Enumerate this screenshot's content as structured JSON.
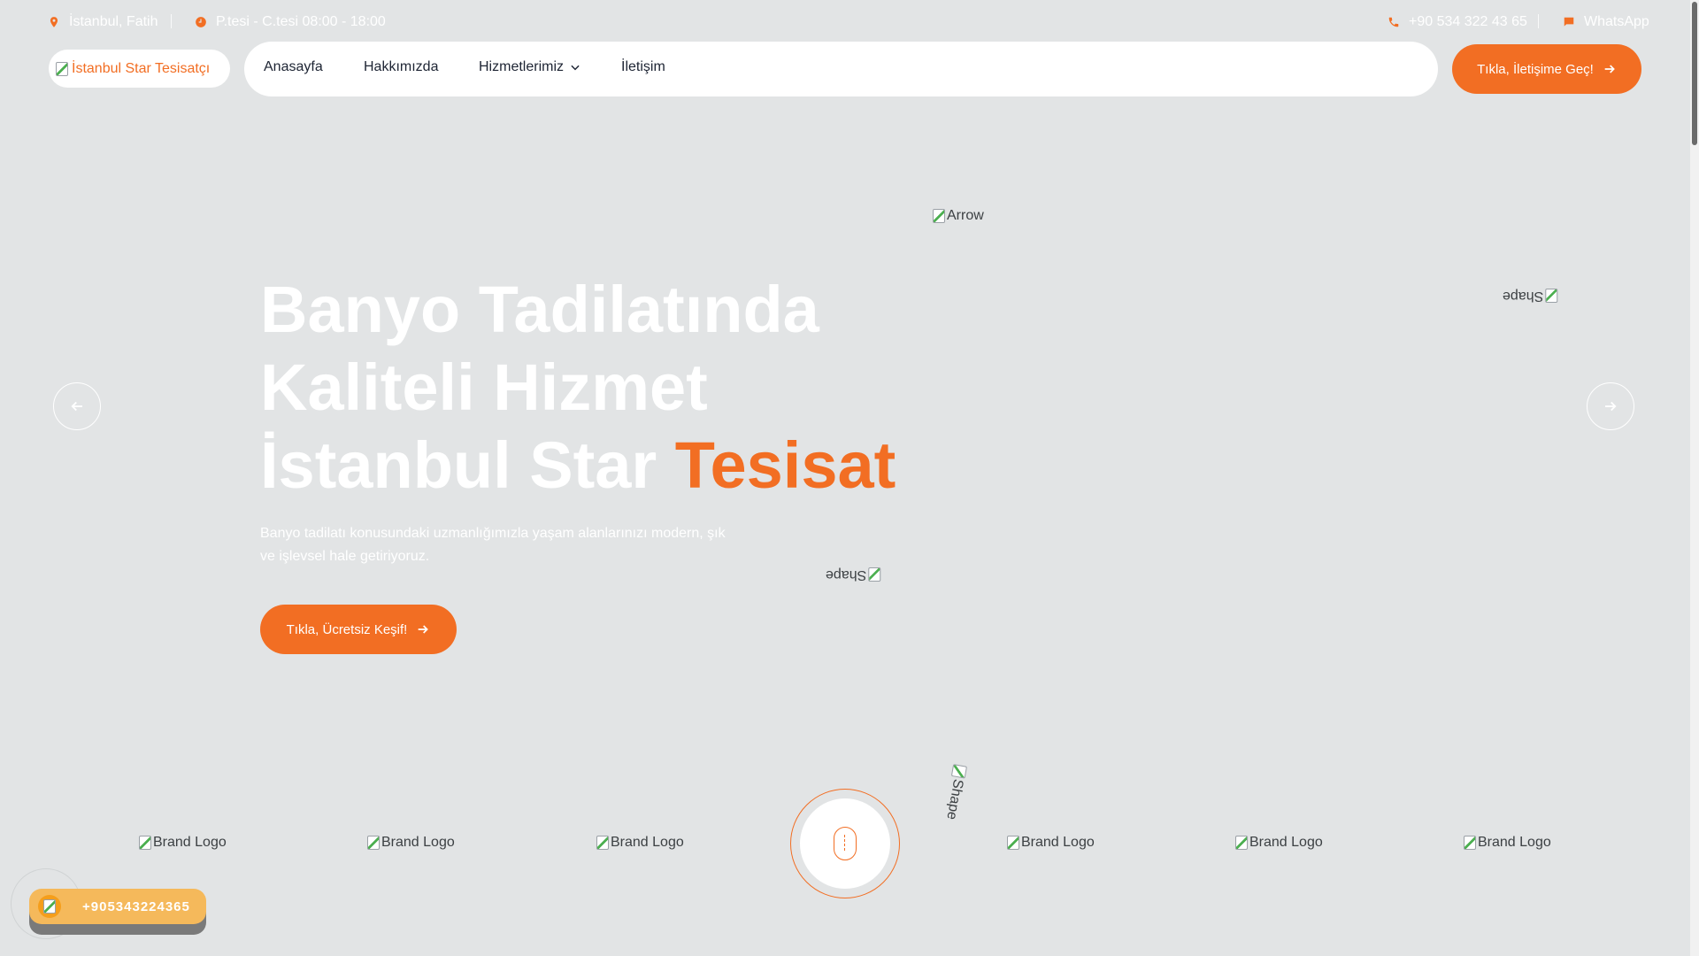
{
  "topbar": {
    "location": "İstanbul, Fatih",
    "hours": "P.tesi - C.tesi 08:00 - 18:00",
    "phone": "+90 534 322 43 65",
    "whatsapp": "WhatsApp"
  },
  "header": {
    "logo_alt": "İstanbul Star Tesisatçı",
    "nav": [
      "Anasayfa",
      "Hakkımızda",
      "Hizmetlerimiz",
      "İletişim"
    ],
    "cta": "Tıkla, İletişime Geç!"
  },
  "hero": {
    "title_line1": "Banyo Tadilatında",
    "title_line2": "Kaliteli Hizmet",
    "title_line3_plain": "İstanbul Star ",
    "title_line3_accent": "Tesisat",
    "description": "Banyo tadilatı konusundaki uzmanlığımızla yaşam alanlarınızı modern, şık ve işlevsel hale getiriyoruz.",
    "cta": "Tıkla, Ücretsiz Keşif!",
    "arrow_alt": "Arrow",
    "shape_alt": "Shape"
  },
  "brands": {
    "alt": "Brand Logo"
  },
  "phone_widget": {
    "number": "+905343224365"
  },
  "colors": {
    "accent": "#f26e23",
    "background": "#e2e4e5",
    "phone_pill": "#f5b95b"
  }
}
